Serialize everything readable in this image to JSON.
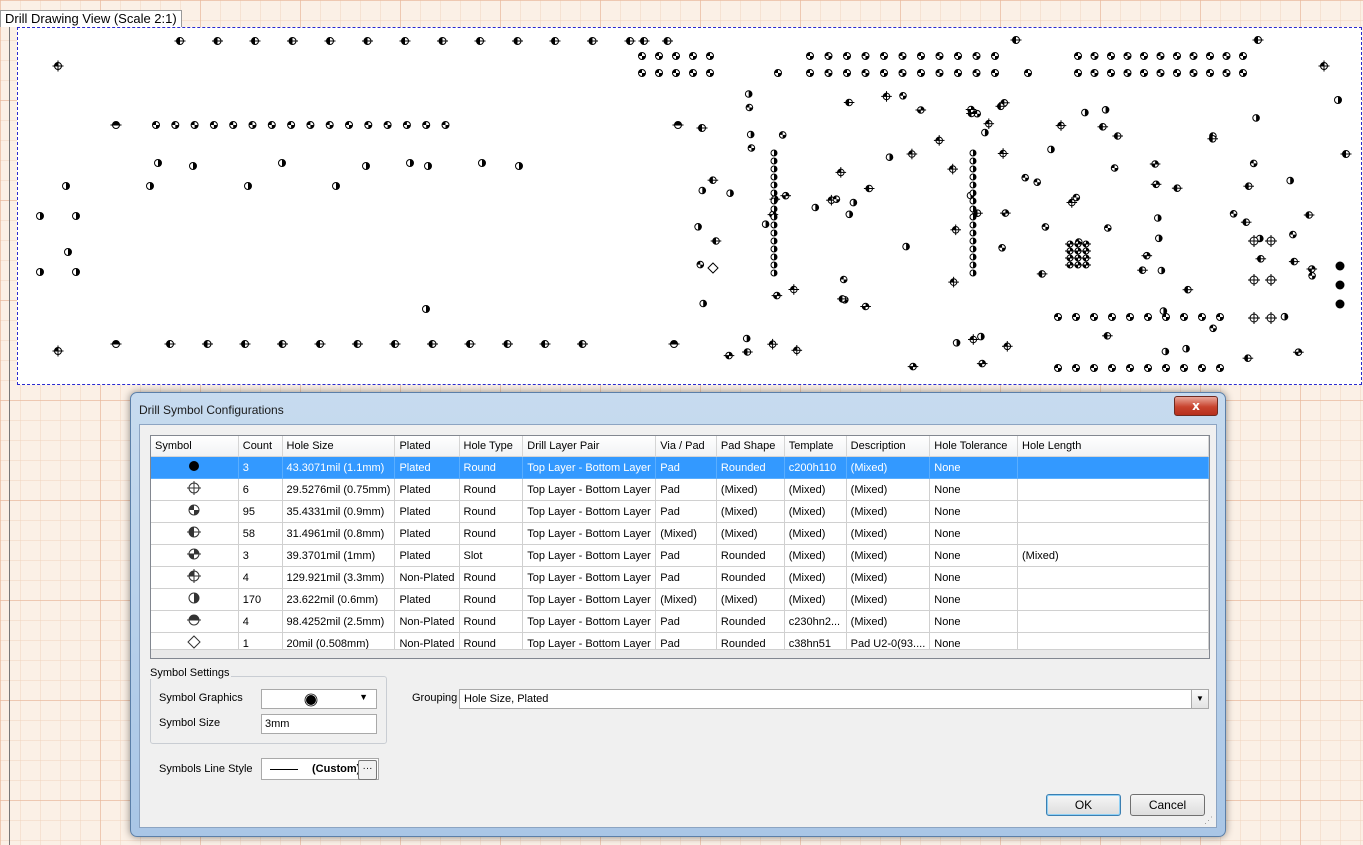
{
  "view": {
    "title": "Drill Drawing View (Scale 2:1)"
  },
  "dialog": {
    "title": "Drill Symbol Configurations",
    "close_label": "x",
    "columns": [
      "Symbol",
      "Count",
      "Hole Size",
      "Plated",
      "Hole Type",
      "Drill Layer Pair",
      "Via / Pad",
      "Pad Shape",
      "Template",
      "Description",
      "Hole Tolerance",
      "Hole Length"
    ],
    "rows": [
      {
        "symbol": "filled-circle-icon",
        "count": "3",
        "hole_size": "43.3071mil (1.1mm)",
        "plated": "Plated",
        "hole_type": "Round",
        "layer_pair": "Top Layer - Bottom Layer",
        "via_pad": "Pad",
        "pad_shape": "Rounded",
        "template": "c200h110",
        "description": "(Mixed)",
        "tolerance": "None",
        "length": "",
        "selected": true
      },
      {
        "symbol": "crosshair-circle-icon",
        "count": "6",
        "hole_size": "29.5276mil (0.75mm)",
        "plated": "Plated",
        "hole_type": "Round",
        "layer_pair": "Top Layer - Bottom Layer",
        "via_pad": "Pad",
        "pad_shape": "(Mixed)",
        "template": "(Mixed)",
        "description": "(Mixed)",
        "tolerance": "None",
        "length": ""
      },
      {
        "symbol": "quadrant-diagonal-icon",
        "count": "95",
        "hole_size": "35.4331mil (0.9mm)",
        "plated": "Plated",
        "hole_type": "Round",
        "layer_pair": "Top Layer - Bottom Layer",
        "via_pad": "Pad",
        "pad_shape": "(Mixed)",
        "template": "(Mixed)",
        "description": "(Mixed)",
        "tolerance": "None",
        "length": ""
      },
      {
        "symbol": "half-left-filled-icon",
        "count": "58",
        "hole_size": "31.4961mil (0.8mm)",
        "plated": "Plated",
        "hole_type": "Round",
        "layer_pair": "Top Layer - Bottom Layer",
        "via_pad": "(Mixed)",
        "pad_shape": "(Mixed)",
        "template": "(Mixed)",
        "description": "(Mixed)",
        "tolerance": "None",
        "length": ""
      },
      {
        "symbol": "quadrant-split-icon",
        "count": "3",
        "hole_size": "39.3701mil (1mm)",
        "plated": "Plated",
        "hole_type": "Slot",
        "layer_pair": "Top Layer - Bottom Layer",
        "via_pad": "Pad",
        "pad_shape": "Rounded",
        "template": "(Mixed)",
        "description": "(Mixed)",
        "tolerance": "None",
        "length": "(Mixed)"
      },
      {
        "symbol": "quadrant-top-left-icon",
        "count": "4",
        "hole_size": "129.921mil (3.3mm)",
        "plated": "Non-Plated",
        "hole_type": "Round",
        "layer_pair": "Top Layer - Bottom Layer",
        "via_pad": "Pad",
        "pad_shape": "Rounded",
        "template": "(Mixed)",
        "description": "(Mixed)",
        "tolerance": "None",
        "length": ""
      },
      {
        "symbol": "half-right-filled-icon",
        "count": "170",
        "hole_size": "23.622mil (0.6mm)",
        "plated": "Plated",
        "hole_type": "Round",
        "layer_pair": "Top Layer - Bottom Layer",
        "via_pad": "(Mixed)",
        "pad_shape": "(Mixed)",
        "template": "(Mixed)",
        "description": "(Mixed)",
        "tolerance": "None",
        "length": ""
      },
      {
        "symbol": "half-top-filled-icon",
        "count": "4",
        "hole_size": "98.4252mil (2.5mm)",
        "plated": "Non-Plated",
        "hole_type": "Round",
        "layer_pair": "Top Layer - Bottom Layer",
        "via_pad": "Pad",
        "pad_shape": "Rounded",
        "template": "c230hn2...",
        "description": "(Mixed)",
        "tolerance": "None",
        "length": ""
      },
      {
        "symbol": "diamond-icon",
        "count": "1",
        "hole_size": "20mil (0.508mm)",
        "plated": "Non-Plated",
        "hole_type": "Round",
        "layer_pair": "Top Layer - Bottom Layer",
        "via_pad": "Pad",
        "pad_shape": "Rounded",
        "template": "c38hn51",
        "description": "Pad U2-0(93....",
        "tolerance": "None",
        "length": ""
      }
    ],
    "settings": {
      "group_title": "Symbol Settings",
      "graphics_label": "Symbol Graphics",
      "graphics_value_icon": "filled-circle-icon",
      "size_label": "Symbol Size",
      "size_value": "3mm",
      "line_style_label": "Symbols Line Style",
      "line_style_value": "(Custom)",
      "line_style_more": "···"
    },
    "grouping": {
      "label": "Grouping",
      "value": "Hole Size, Plated"
    },
    "buttons": {
      "ok": "OK",
      "cancel": "Cancel"
    }
  }
}
